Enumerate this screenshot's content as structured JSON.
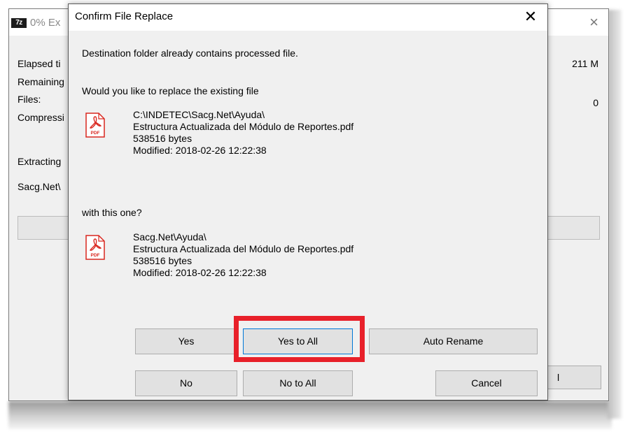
{
  "background_window": {
    "title": "0% Ex",
    "app_icon_text": "7z",
    "close_glyph": "×",
    "labels": [
      "Elapsed ti",
      "Remaining",
      "Files:",
      "Compressi",
      "Extracting",
      "Sacg.Net\\"
    ],
    "values": {
      "size": "211 M",
      "files": "0"
    },
    "button_fragment": "l"
  },
  "dialog": {
    "title": "Confirm File Replace",
    "close_glyph": "✕",
    "message": "Destination folder already contains processed file.",
    "question": "Would you like to replace the existing file",
    "existing_file": {
      "path": "C:\\INDETEC\\Sacg.Net\\Ayuda\\",
      "name": "Estructura Actualizada del Módulo de Reportes.pdf",
      "size": "538516 bytes",
      "modified": "Modified: 2018-02-26 12:22:38",
      "icon": "pdf-file-icon"
    },
    "with_text": "with this one?",
    "new_file": {
      "path": "Sacg.Net\\Ayuda\\",
      "name": "Estructura Actualizada del Módulo de Reportes.pdf",
      "size": "538516 bytes",
      "modified": "Modified: 2018-02-26 12:22:38",
      "icon": "pdf-file-icon"
    },
    "buttons": {
      "yes": "Yes",
      "yes_to_all": "Yes to All",
      "auto_rename": "Auto Rename",
      "no": "No",
      "no_to_all": "No to All",
      "cancel": "Cancel"
    }
  },
  "colors": {
    "highlight": "#e8202a",
    "pdf_red": "#d9271f",
    "dialog_bg": "#f0f0f0",
    "button_bg": "#e1e1e1"
  }
}
